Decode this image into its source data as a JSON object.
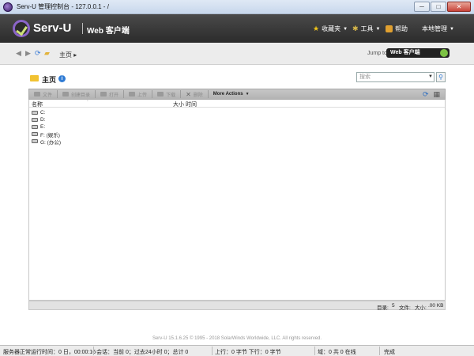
{
  "window": {
    "title": "Serv-U 管理控制台 - 127.0.0.1 - /",
    "controls": {
      "minimize": "─",
      "maximize": "□",
      "close": "✕"
    }
  },
  "header": {
    "logo": "Serv-U",
    "subtitle": "Web 客户端",
    "menu": {
      "favorites": "收藏夹",
      "tools": "工具",
      "help": "帮助",
      "local_admin": "本地管理"
    }
  },
  "nav": {
    "breadcrumb": "主页",
    "jump_label": "Jump to:",
    "jump_value": "Web 客户端"
  },
  "main": {
    "title": "主页",
    "search_placeholder": "搜索",
    "toolbar": {
      "new_file": "文件",
      "new_folder": "创建目录",
      "open": "打开",
      "upload": "上传",
      "download": "下载",
      "delete": "删除",
      "more_actions": "More Actions"
    },
    "columns": {
      "name": "名称",
      "size": "大小",
      "time": "时间"
    },
    "rows": [
      {
        "name": "C:"
      },
      {
        "name": "D:"
      },
      {
        "name": "E:"
      },
      {
        "name": "F: (娱乐)"
      },
      {
        "name": "G: (办公)"
      }
    ],
    "status": {
      "dirs_label": "目录:",
      "dirs_value": "5",
      "files_label": "文件:",
      "size_label": "大小:",
      "size_value": ".00 KB"
    }
  },
  "footer": "Serv-U 15.1.6.25 © 1995 - 2018 SolarWinds Worldwide, LLC. All rights reserved.",
  "statusbar": {
    "uptime": "服务器正常运行时间：0 日，00:00:16",
    "sessions": "会话：当前 0；过去24小时 0；总计 0",
    "transfer": "上行：0 字节 下行：0 字节",
    "domains": "域：0 共 0 在线",
    "state": "完成"
  }
}
